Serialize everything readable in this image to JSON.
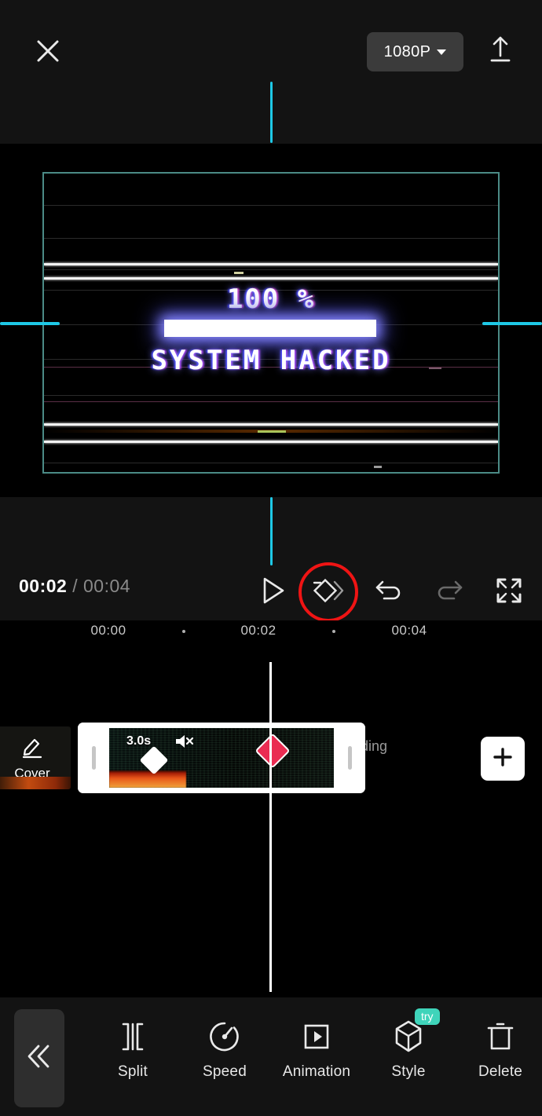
{
  "topbar": {
    "close_icon": "close-icon",
    "resolution_label": "1080P",
    "resolution_caret": "chevron-down-icon",
    "export_icon": "export-upload-icon"
  },
  "preview": {
    "percent_text": "100 %",
    "status_text": "SYSTEM HACKED",
    "progress_percent": 100,
    "selection_border_color": "#4b8b86",
    "guide_color": "#1ec8e6"
  },
  "playback": {
    "current_time": "00:02",
    "separator": "/",
    "total_time": "00:04",
    "play_icon": "play-icon",
    "keyframe_icon": "keyframe-icon",
    "undo_icon": "undo-icon",
    "redo_icon": "redo-icon",
    "fullscreen_icon": "fullscreen-icon",
    "highlight_color": "#ef1414"
  },
  "ruler": {
    "labels": [
      "00:00",
      "00:02",
      "00:04"
    ],
    "dots": 2
  },
  "timeline": {
    "cover_label": "Cover",
    "cover_icon": "pencil-edit-icon",
    "clip": {
      "duration_label": "3.0s",
      "mute_icon": "speaker-muted-icon",
      "keyframe_start": "keyframe-diamond-white",
      "keyframe_playhead": "keyframe-diamond-red",
      "keyframe_color": "#ea2c52"
    },
    "ending_label": "Ending",
    "add_icon": "plus-icon"
  },
  "toolbar": {
    "collapse_icon": "chevron-double-left-icon",
    "items": [
      {
        "label": "Split",
        "icon": "split-icon",
        "badge": ""
      },
      {
        "label": "Speed",
        "icon": "speed-gauge-icon",
        "badge": ""
      },
      {
        "label": "Animation",
        "icon": "animation-play-box-icon",
        "badge": ""
      },
      {
        "label": "Style",
        "icon": "cube-3d-icon",
        "badge": "try"
      },
      {
        "label": "Delete",
        "icon": "trash-icon",
        "badge": ""
      }
    ],
    "badge_color": "#3fd4ba"
  }
}
